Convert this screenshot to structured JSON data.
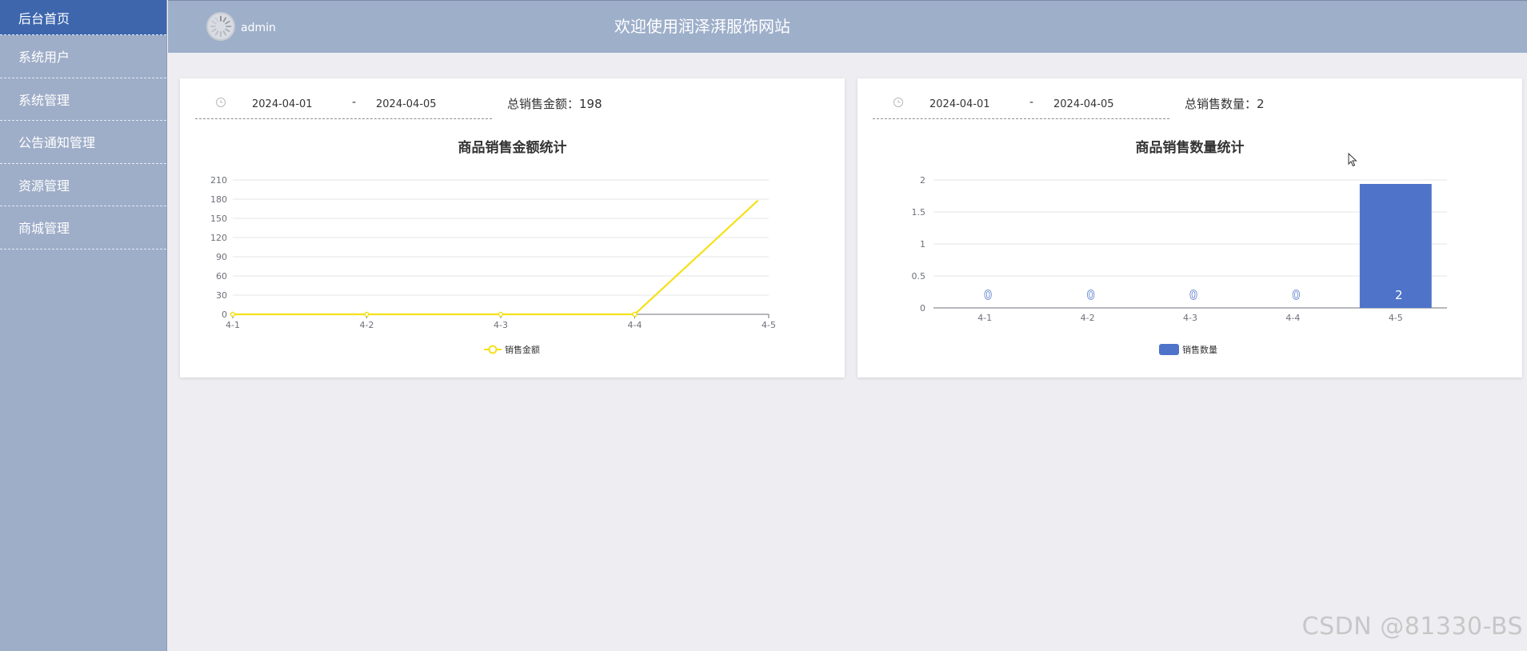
{
  "sidebar": {
    "items": [
      {
        "label": "后台首页",
        "active": true
      },
      {
        "label": "系统用户",
        "active": false
      },
      {
        "label": "系统管理",
        "active": false
      },
      {
        "label": "公告通知管理",
        "active": false
      },
      {
        "label": "资源管理",
        "active": false
      },
      {
        "label": "商城管理",
        "active": false
      }
    ]
  },
  "header": {
    "username": "admin",
    "title": "欢迎使用润泽湃服饰网站"
  },
  "cards": {
    "amount": {
      "start_date": "2024-04-01",
      "separator": "-",
      "end_date": "2024-04-05",
      "total_label": "总销售金额：198"
    },
    "quantity": {
      "start_date": "2024-04-01",
      "separator": "-",
      "end_date": "2024-04-05",
      "total_label": "总销售数量：2"
    }
  },
  "chart_data": [
    {
      "type": "line",
      "title": "商品销售金额统计",
      "categories": [
        "4-1",
        "4-2",
        "4-3",
        "4-4",
        "4-5"
      ],
      "series": [
        {
          "name": "销售金额",
          "values": [
            0,
            0,
            0,
            0,
            178
          ]
        }
      ],
      "y_ticks": [
        "0",
        "30",
        "60",
        "90",
        "120",
        "150",
        "180",
        "210"
      ],
      "ylim": [
        0,
        210
      ],
      "color": "#f5e01a",
      "legend": "bottom-center",
      "grid": true
    },
    {
      "type": "bar",
      "title": "商品销售数量统计",
      "categories": [
        "4-1",
        "4-2",
        "4-3",
        "4-4",
        "4-5"
      ],
      "series": [
        {
          "name": "销售数量",
          "values": [
            0,
            0,
            0,
            0,
            2
          ]
        }
      ],
      "data_labels": [
        "0",
        "0",
        "0",
        "0",
        "2"
      ],
      "y_ticks": [
        "0",
        "0.5",
        "1",
        "1.5",
        "2"
      ],
      "ylim": [
        0,
        2
      ],
      "color": "#4e73c9",
      "legend": "bottom-center",
      "grid": true
    }
  ],
  "watermark": "CSDN @81330-BS",
  "colors": {
    "sidebar_bg": "#9eadc8",
    "sidebar_active": "#3d66ad",
    "topbar_bg": "#9eafca",
    "page_bg": "#eeeef2"
  }
}
